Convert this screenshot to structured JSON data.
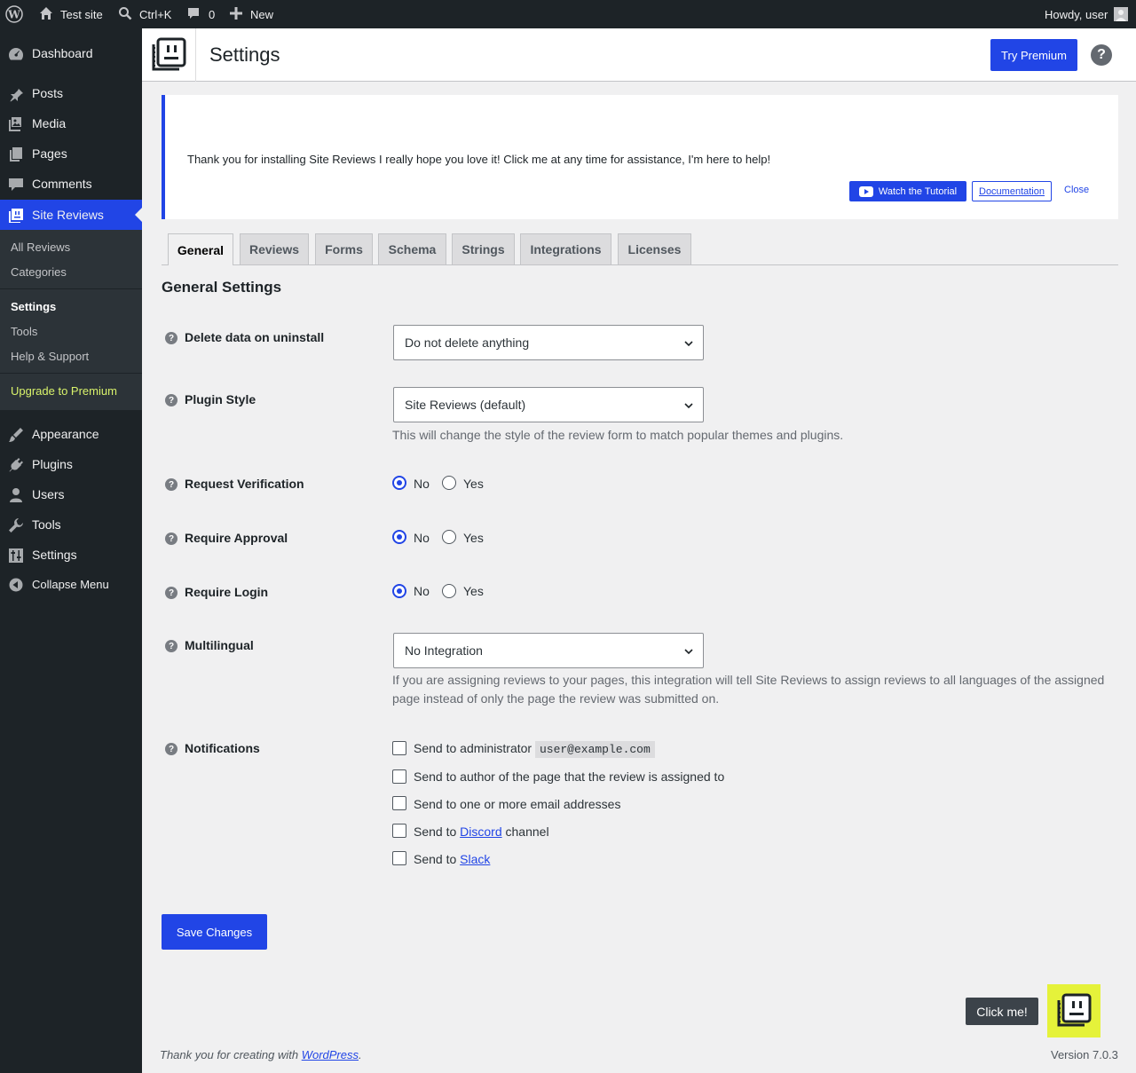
{
  "adminbar": {
    "site_name": "Test site",
    "search_shortcut": "Ctrl+K",
    "comments_count": "0",
    "new_label": "New",
    "howdy": "Howdy, user"
  },
  "sidebar": {
    "items": [
      {
        "label": "Dashboard",
        "icon": "dashboard-icon"
      },
      {
        "label": "Posts",
        "icon": "pin-icon"
      },
      {
        "label": "Media",
        "icon": "media-icon"
      },
      {
        "label": "Pages",
        "icon": "pages-icon"
      },
      {
        "label": "Comments",
        "icon": "comment-icon"
      },
      {
        "label": "Site Reviews",
        "icon": "site-reviews-icon"
      },
      {
        "label": "Appearance",
        "icon": "brush-icon"
      },
      {
        "label": "Plugins",
        "icon": "plug-icon"
      },
      {
        "label": "Users",
        "icon": "user-icon"
      },
      {
        "label": "Tools",
        "icon": "wrench-icon"
      },
      {
        "label": "Settings",
        "icon": "sliders-icon"
      },
      {
        "label": "Collapse Menu",
        "icon": "collapse-icon"
      }
    ],
    "submenu": [
      "All Reviews",
      "Categories",
      "Settings",
      "Tools",
      "Help & Support",
      "Upgrade to Premium"
    ],
    "upgrade_color": "#d9f36b"
  },
  "header": {
    "title": "Settings",
    "try_premium": "Try Premium",
    "help": "?"
  },
  "notice": {
    "text": "Thank you for installing Site Reviews I really hope you love it! Click me at any time for assistance, I'm here to help!",
    "watch": "Watch the Tutorial",
    "docs": "Documentation",
    "close": "Close"
  },
  "tabs": [
    "General",
    "Reviews",
    "Forms",
    "Schema",
    "Strings",
    "Integrations",
    "Licenses"
  ],
  "section_title": "General Settings",
  "fields": {
    "delete": {
      "label": "Delete data on uninstall",
      "value": "Do not delete anything"
    },
    "style": {
      "label": "Plugin Style",
      "value": "Site Reviews (default)",
      "desc": "This will change the style of the review form to match popular themes and plugins."
    },
    "verification": {
      "label": "Request Verification"
    },
    "approval": {
      "label": "Require Approval"
    },
    "login": {
      "label": "Require Login"
    },
    "multilingual": {
      "label": "Multilingual",
      "value": "No Integration",
      "desc": "If you are assigning reviews to your pages, this integration will tell Site Reviews to assign reviews to all languages of the assigned page instead of only the page the review was submitted on."
    },
    "notifications": {
      "label": "Notifications"
    }
  },
  "radio": {
    "no": "No",
    "yes": "Yes"
  },
  "notify": {
    "admin": "Send to administrator",
    "admin_email": "user@example.com",
    "author": "Send to author of the page that the review is assigned to",
    "emails": "Send to one or more email addresses",
    "discord_pre": "Send to",
    "discord_link": "Discord",
    "discord_post": "channel",
    "slack_pre": "Send to",
    "slack_link": "Slack"
  },
  "save": "Save Changes",
  "assistant": {
    "click_me": "Click me!"
  },
  "footer": {
    "left_pre": "Thank you for creating with",
    "left_link": "WordPress",
    "left_post": ".",
    "version": "Version 7.0.3"
  },
  "colors": {
    "accent": "#2145e6",
    "admin_dark": "#1d2327",
    "highlight": "#e5f23a"
  }
}
